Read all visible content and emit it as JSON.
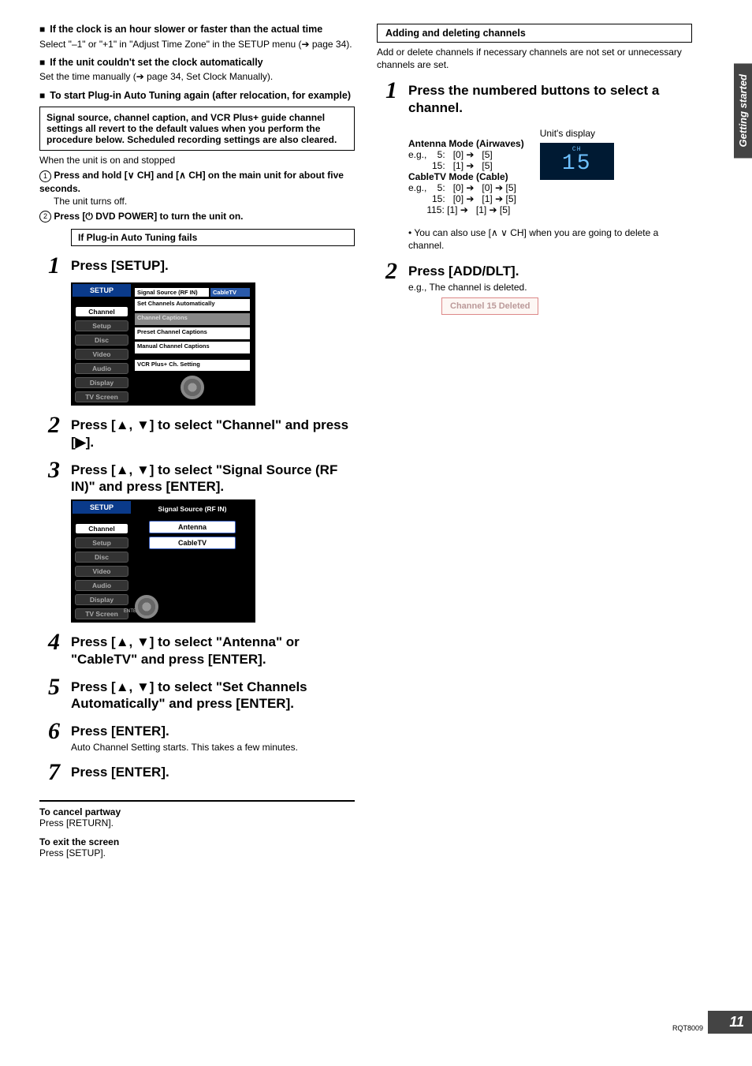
{
  "side_tab": "Getting started",
  "footer": {
    "code": "RQT8009",
    "page": "11"
  },
  "left": {
    "h1": {
      "title": "If the clock is an hour slower or faster than the actual time",
      "body": "Select \"–1\" or \"+1\" in \"Adjust Time Zone\" in the SETUP menu (➔ page 34)."
    },
    "h2": {
      "title": "If the unit couldn't set the clock automatically",
      "body": "Set the time manually (➔ page 34, Set Clock Manually)."
    },
    "h3": {
      "title": "To start Plug-in Auto Tuning again (after relocation, for example)"
    },
    "warn_box": "Signal source, channel caption, and VCR Plus+ guide channel settings all revert to the default values when you perform the procedure below. Scheduled recording settings are also cleared.",
    "pre_hint": "When the unit is on and stopped",
    "sub1": {
      "num": "1",
      "bold": "Press and hold [∨ CH] and [∧ CH] on the main unit for about five seconds.",
      "note": "The unit turns off."
    },
    "sub2": {
      "num": "2",
      "bold": "Press [⏻ DVD POWER] to turn the unit on."
    },
    "fail_box": "If Plug-in Auto Tuning fails",
    "steps": {
      "s1": {
        "title": "Press [SETUP]."
      },
      "s2": {
        "title": "Press [▲, ▼] to select \"Channel\" and press [▶]."
      },
      "s3": {
        "title": "Press [▲, ▼] to select \"Signal Source (RF IN)\" and press [ENTER]."
      },
      "s4": {
        "title": "Press [▲, ▼] to select \"Antenna\" or \"CableTV\" and press [ENTER]."
      },
      "s5": {
        "title": "Press [▲, ▼] to select \"Set Channels Automatically\" and press [ENTER]."
      },
      "s6": {
        "title": "Press [ENTER].",
        "note": "Auto Channel Setting starts. This takes a few minutes."
      },
      "s7": {
        "title": "Press [ENTER]."
      }
    },
    "menu1": {
      "title": "SETUP",
      "items": [
        "Channel",
        "Setup",
        "Disc",
        "Video",
        "Audio",
        "Display",
        "TV Screen"
      ],
      "opts": {
        "row1_a": "Signal Source (RF IN)",
        "row1_b": "CableTV",
        "row2": "Set Channels Automatically",
        "row3": "Channel Captions",
        "row4": "Preset Channel Captions",
        "row5": "Manual Channel Captions",
        "row6": "VCR Plus+ Ch. Setting"
      }
    },
    "menu2": {
      "title": "SETUP",
      "items": [
        "Channel",
        "Setup",
        "Disc",
        "Video",
        "Audio",
        "Display",
        "TV Screen"
      ],
      "header": "Signal Source (RF IN)",
      "opt_a": "Antenna",
      "opt_b": "CableTV",
      "enter": "ENTER"
    },
    "tail": {
      "cancel_h": "To cancel partway",
      "cancel_b": "Press [RETURN].",
      "exit_h": "To exit the screen",
      "exit_b": "Press [SETUP]."
    }
  },
  "right": {
    "box_title": "Adding and deleting channels",
    "box_body": "Add or delete channels if necessary channels are not set or unnecessary channels are set.",
    "s1": {
      "title": "Press the numbered buttons to select a channel.",
      "ant_h": "Antenna Mode (Airwaves)",
      "ant_l1": "e.g.,    5:   [0] ➔   [5]",
      "ant_l2": "         15:   [1] ➔   [5]",
      "cab_h": "CableTV Mode (Cable)",
      "cab_l1": "e.g.,    5:   [0] ➔   [0] ➔ [5]",
      "cab_l2": "         15:   [0] ➔   [1] ➔ [5]",
      "cab_l3": "       115: [1] ➔   [1] ➔ [5]",
      "disp_label": "Unit's display",
      "disp_ch": "CH",
      "disp_val": "15",
      "note": "You can also use [∧ ∨ CH] when you are going to delete a channel."
    },
    "s2": {
      "title": "Press [ADD/DLT].",
      "note": "e.g., The channel is deleted.",
      "status": "Channel 15 Deleted"
    }
  }
}
